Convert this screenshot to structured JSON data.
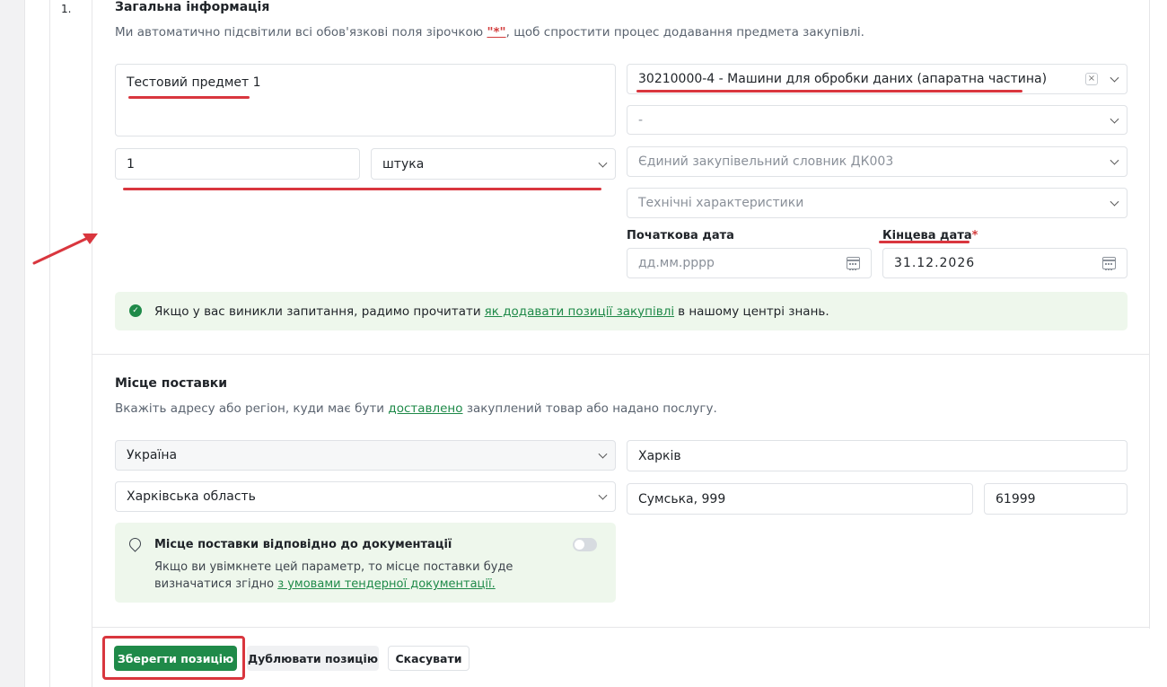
{
  "section_number": "1.",
  "general": {
    "title": "Загальна інформація",
    "subtitle_prefix": "Ми автоматично підсвітили всі обов'язкові поля зірочкою ",
    "subtitle_star": "\"*\"",
    "subtitle_suffix": ", щоб спростити процес додавання предмета закупівлі.",
    "item_name": "Тестовий предмет 1",
    "quantity": "1",
    "unit": "штука",
    "cpv": "30210000-4 - Машини для обробки даних (апаратна частина)",
    "cpv_clear": "×",
    "additional_classifier": "-",
    "dk003_placeholder": "Єдиний закупівельний словник ДК003",
    "specs_placeholder": "Технічні характеристики",
    "start_date_label": "Початкова дата",
    "start_date_placeholder": "дд.мм.рррр",
    "end_date_label": "Кінцева дата",
    "end_date_required": "*",
    "end_date_value": "31.12.2026"
  },
  "help": {
    "prefix": "Якщо у вас виникли запитання, радимо прочитати",
    "link": "як додавати позиції закупівлі",
    "suffix": "в нашому центрі знань."
  },
  "delivery": {
    "title": "Місце поставки",
    "subtitle_prefix": "Вкажіть адресу або регіон, куди має бути ",
    "subtitle_link": "доставлено",
    "subtitle_suffix": " закуплений товар або надано послугу.",
    "country": "Україна",
    "region": "Харківська область",
    "city": "Харків",
    "street": "Сумська, 999",
    "postal_code": "61999",
    "doc_title": "Місце поставки відповідно до документації",
    "doc_desc_prefix": "Якщо ви увімкнете цей параметр, то місце поставки буде визначатися згідно ",
    "doc_desc_link": "з умовами тендерної документації.",
    "doc_toggle_on": false
  },
  "actions": {
    "save": "Зберегти позицію",
    "duplicate": "Дублювати позицію",
    "cancel": "Скасувати"
  },
  "colors": {
    "accent_green": "#1f8a49",
    "annotation_red": "#d9363e",
    "info_bg": "#eef7ec"
  }
}
